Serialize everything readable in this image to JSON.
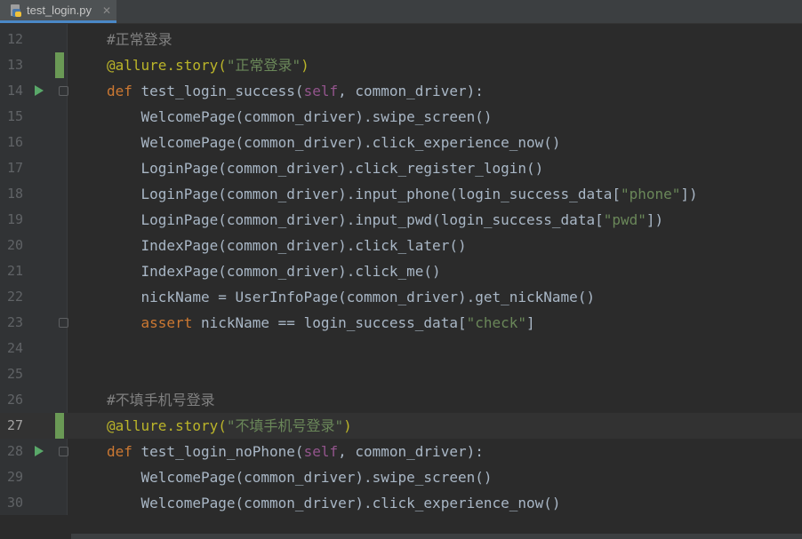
{
  "tab": {
    "label": "test_login.py",
    "close": "✕",
    "icon": "python-file-icon"
  },
  "lines": [
    {
      "n": "12",
      "tokens": [
        [
          "c-comment",
          "#正常登录"
        ]
      ]
    },
    {
      "n": "13",
      "tokens": [
        [
          "c-deco",
          "@allure.story("
        ],
        [
          "c-string",
          "\"正常登录\""
        ],
        [
          "c-deco",
          ")"
        ]
      ]
    },
    {
      "n": "14",
      "tokens": [
        [
          "c-kw",
          "def "
        ],
        [
          "c-fn",
          "test_login_success"
        ],
        [
          "",
          "("
        ],
        [
          "c-self",
          "self"
        ],
        [
          "",
          ", "
        ],
        [
          "c-param",
          "common_driver"
        ],
        [
          "",
          "):"
        ]
      ]
    },
    {
      "n": "15",
      "tokens": [
        [
          "",
          "    WelcomePage("
        ],
        [
          "",
          "common_driver"
        ],
        [
          "",
          ").swipe_screen()"
        ]
      ]
    },
    {
      "n": "16",
      "tokens": [
        [
          "",
          "    WelcomePage("
        ],
        [
          "",
          "common_driver"
        ],
        [
          "",
          ").click_experience_now()"
        ]
      ]
    },
    {
      "n": "17",
      "tokens": [
        [
          "",
          "    LoginPage("
        ],
        [
          "",
          "common_driver"
        ],
        [
          "",
          ").click_register_login()"
        ]
      ]
    },
    {
      "n": "18",
      "tokens": [
        [
          "",
          "    LoginPage("
        ],
        [
          "",
          "common_driver"
        ],
        [
          "",
          ").input_phone(login_success_data["
        ],
        [
          "c-string",
          "\"phone\""
        ],
        [
          "",
          "])"
        ]
      ]
    },
    {
      "n": "19",
      "tokens": [
        [
          "",
          "    LoginPage("
        ],
        [
          "",
          "common_driver"
        ],
        [
          "",
          ").input_pwd(login_success_data["
        ],
        [
          "c-string",
          "\"pwd\""
        ],
        [
          "",
          "])"
        ]
      ]
    },
    {
      "n": "20",
      "tokens": [
        [
          "",
          "    IndexPage("
        ],
        [
          "",
          "common_driver"
        ],
        [
          "",
          ").click_later()"
        ]
      ]
    },
    {
      "n": "21",
      "tokens": [
        [
          "",
          "    IndexPage("
        ],
        [
          "",
          "common_driver"
        ],
        [
          "",
          ").click_me()"
        ]
      ]
    },
    {
      "n": "22",
      "tokens": [
        [
          "",
          "    nickName = UserInfoPage("
        ],
        [
          "",
          "common_driver"
        ],
        [
          "",
          ").get_nickName()"
        ]
      ]
    },
    {
      "n": "23",
      "tokens": [
        [
          "c-kw",
          "    assert "
        ],
        [
          "",
          "nickName == login_success_data["
        ],
        [
          "c-string",
          "\"check\""
        ],
        [
          "",
          "]"
        ]
      ]
    },
    {
      "n": "24",
      "tokens": []
    },
    {
      "n": "25",
      "tokens": []
    },
    {
      "n": "26",
      "tokens": [
        [
          "c-comment",
          "#不填手机号登录"
        ]
      ]
    },
    {
      "n": "27",
      "tokens": [
        [
          "c-deco",
          "@allure.story("
        ],
        [
          "c-string",
          "\"不填手机号登录\""
        ],
        [
          "c-deco",
          ")"
        ]
      ]
    },
    {
      "n": "28",
      "tokens": [
        [
          "c-kw",
          "def "
        ],
        [
          "c-fn",
          "test_login_noPhone"
        ],
        [
          "",
          "("
        ],
        [
          "c-self",
          "self"
        ],
        [
          "",
          ", "
        ],
        [
          "c-param",
          "common_driver"
        ],
        [
          "",
          "):"
        ]
      ]
    },
    {
      "n": "29",
      "tokens": [
        [
          "",
          "    WelcomePage("
        ],
        [
          "",
          "common_driver"
        ],
        [
          "",
          ").swipe_screen()"
        ]
      ]
    },
    {
      "n": "30",
      "tokens": [
        [
          "",
          "    WelcomePage("
        ],
        [
          "",
          "common_driver"
        ],
        [
          "",
          ").click_experience_now()"
        ]
      ]
    }
  ],
  "current_line": "27",
  "change_marker_lines": [
    "13",
    "27"
  ],
  "run_icon_lines": [
    "14",
    "28"
  ],
  "fold_icon_lines": [
    "14",
    "23",
    "28"
  ],
  "colors": {
    "background": "#2b2b2b",
    "gutter": "#313335",
    "change": "#6a9955",
    "run": "#59a869"
  }
}
